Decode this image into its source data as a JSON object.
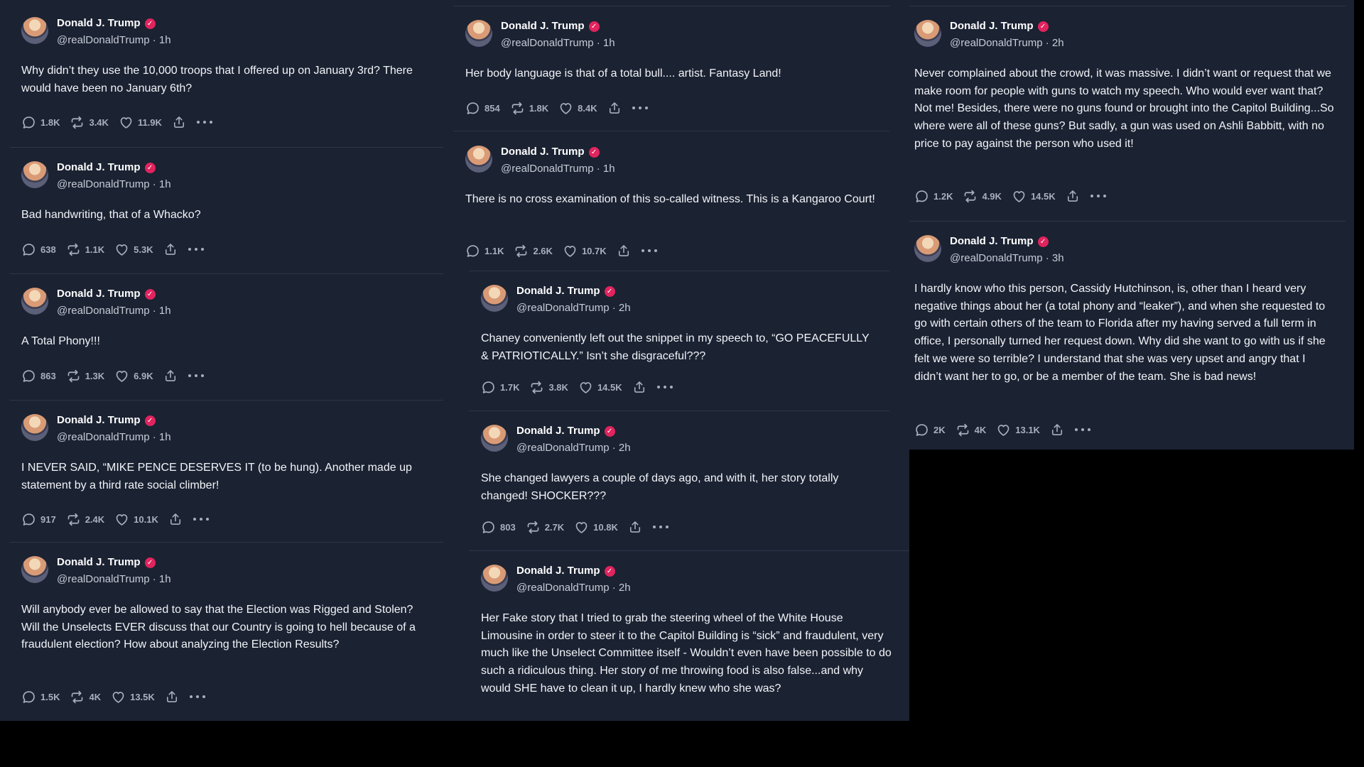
{
  "author": {
    "name": "Donald J. Trump",
    "handle": "@realDonaldTrump",
    "verified_icon": "verified-badge-icon"
  },
  "colors": {
    "background": "#1b2232",
    "badge": "#e0245e",
    "icon": "#a9afbc"
  },
  "columns": [
    {
      "posts": [
        {
          "time": "1h",
          "text": "Why didn’t they use the 10,000 troops that I offered up on January 3rd? There would have been no January 6th?",
          "replies": "1.8K",
          "reposts": "3.4K",
          "likes": "11.9K"
        },
        {
          "time": "1h",
          "text": "Bad handwriting, that of a Whacko?",
          "replies": "638",
          "reposts": "1.1K",
          "likes": "5.3K"
        },
        {
          "time": "1h",
          "text": "A Total Phony!!!",
          "replies": "863",
          "reposts": "1.3K",
          "likes": "6.9K"
        },
        {
          "time": "1h",
          "text": "I NEVER SAID, “MIKE PENCE DESERVES IT (to be hung). Another made up statement by a third rate social climber!",
          "replies": "917",
          "reposts": "2.4K",
          "likes": "10.1K"
        },
        {
          "time": "1h",
          "text": "Will anybody ever be allowed to say that the Election was Rigged and Stolen? Will the Unselects EVER discuss that our Country is going to hell because of a fraudulent election? How about analyzing the Election Results?",
          "replies": "1.5K",
          "reposts": "4K",
          "likes": "13.5K"
        }
      ]
    },
    {
      "posts": [
        {
          "time": "1h",
          "text": "Her body language is that of a total bull.... artist. Fantasy Land!",
          "replies": "854",
          "reposts": "1.8K",
          "likes": "8.4K"
        },
        {
          "time": "1h",
          "text": "There is no cross examination of this so-called witness. This is a Kangaroo Court!",
          "replies": "1.1K",
          "reposts": "2.6K",
          "likes": "10.7K"
        },
        {
          "time": "2h",
          "text": "Chaney conveniently left out the snippet in my speech to, “GO PEACEFULLY & PATRIOTICALLY.” Isn’t she disgraceful???",
          "replies": "1.7K",
          "reposts": "3.8K",
          "likes": "14.5K"
        },
        {
          "time": "2h",
          "text": "She changed lawyers a couple of days ago, and with it, her story totally changed! SHOCKER???",
          "replies": "803",
          "reposts": "2.7K",
          "likes": "10.8K"
        },
        {
          "time": "2h",
          "text": "Her Fake story that I tried to  grab the steering wheel of the White House Limousine in order to steer it to the Capitol Building is “sick” and fraudulent, very much like the Unselect Committee itself - Wouldn’t even have been possible to do such a ridiculous thing. Her story of me throwing food is also false...and why would SHE have to clean it up, I hardly knew who she was?",
          "replies": "",
          "reposts": "",
          "likes": ""
        }
      ]
    },
    {
      "posts": [
        {
          "time": "2h",
          "text": "Never complained about the crowd, it was massive. I didn’t want or request that we make room for people with guns to watch my speech. Who would ever want that? Not me! Besides, there were no guns found or brought into the Capitol Building...So where were all of these guns? But sadly, a gun was used on Ashli Babbitt, with no price to pay against the person who used it!",
          "replies": "1.2K",
          "reposts": "4.9K",
          "likes": "14.5K"
        },
        {
          "time": "3h",
          "text": "I hardly know who this person, Cassidy Hutchinson, is, other than I heard very negative things about her (a total phony and “leaker”), and when she requested to go with certain others of the team to Florida after my having served a full term in office, I personally turned her request down. Why did she want to go with us if she felt we were so terrible? I understand that she was very upset and angry that I didn’t want her to go, or be a member of the team. She is bad news!",
          "replies": "2K",
          "reposts": "4K",
          "likes": "13.1K"
        }
      ]
    }
  ]
}
